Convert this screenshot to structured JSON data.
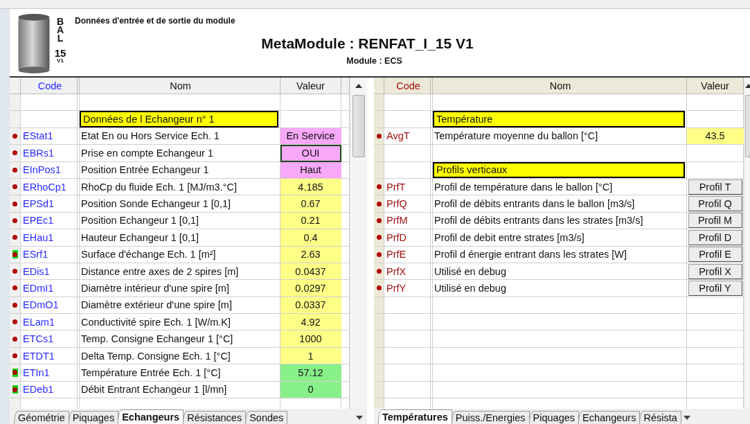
{
  "header": {
    "badge_letters": [
      "B",
      "A",
      "L"
    ],
    "badge_number": "15",
    "badge_version": "V1",
    "caption": "Données d'entrée et de sortie du module",
    "title": "MetaModule : RENFAT_I_15 V1",
    "subtitle": "Module : ECS"
  },
  "grids": [
    {
      "columns": [
        "Code",
        "Nom",
        "Valeur"
      ],
      "rows": [
        {
          "kind": "blank"
        },
        {
          "kind": "section",
          "label": "Données de l Echangeur n° 1"
        },
        {
          "kind": "param",
          "highlighted": false,
          "code": "EStat1",
          "name": "Etat En ou Hors Service Ech. 1",
          "value": "En Service",
          "color": "#f8a8f8",
          "selected": false
        },
        {
          "kind": "param",
          "highlighted": false,
          "code": "EBRs1",
          "name": "Prise en compte Echangeur 1",
          "value": "OUI",
          "color": "#f8a8f8",
          "selected": true
        },
        {
          "kind": "param",
          "highlighted": false,
          "code": "EInPos1",
          "name": "Position Entrée Echangeur 1",
          "value": "Haut",
          "color": "#f8a8f8",
          "selected": false
        },
        {
          "kind": "param",
          "highlighted": false,
          "code": "ERhoCp1",
          "name": "RhoCp du fluide Ech. 1 [MJ/m3.°C]",
          "value": "4.185",
          "color": "#ffff88",
          "selected": false
        },
        {
          "kind": "param",
          "highlighted": false,
          "code": "EPSd1",
          "name": "Position Sonde Echangeur 1 [0,1]",
          "value": "0.67",
          "color": "#ffff88",
          "selected": false
        },
        {
          "kind": "param",
          "highlighted": false,
          "code": "EPEc1",
          "name": "Position Echangeur 1  [0,1]",
          "value": "0.21",
          "color": "#ffff88",
          "selected": false
        },
        {
          "kind": "param",
          "highlighted": false,
          "code": "EHau1",
          "name": "Hauteur Echangeur 1 [0,1]",
          "value": "0.4",
          "color": "#ffff88",
          "selected": false
        },
        {
          "kind": "param",
          "highlighted": true,
          "code": "ESrf1",
          "name": "Surface d'échange Ech. 1 [m²]",
          "value": "2.63",
          "color": "#ffff88",
          "selected": false
        },
        {
          "kind": "param",
          "highlighted": false,
          "code": "EDis1",
          "name": "Distance entre axes de 2 spires [m]",
          "value": "0.0437",
          "color": "#ffff88",
          "selected": false
        },
        {
          "kind": "param",
          "highlighted": false,
          "code": "EDmI1",
          "name": "Diamètre intérieur d'une spire [m]",
          "value": "0.0297",
          "color": "#ffff88",
          "selected": false
        },
        {
          "kind": "param",
          "highlighted": false,
          "code": "EDmO1",
          "name": "Diamètre extérieur d'une spire [m]",
          "value": "0.0337",
          "color": "#ffff88",
          "selected": false
        },
        {
          "kind": "param",
          "highlighted": false,
          "code": "ELam1",
          "name": "Conductivité spire Ech. 1 [W/m.K]",
          "value": "4.92",
          "color": "#ffff88",
          "selected": false
        },
        {
          "kind": "param",
          "highlighted": false,
          "code": "ETCs1",
          "name": "Temp. Consigne Echangeur 1 [°C]",
          "value": "1000",
          "color": "#ffff88",
          "selected": false
        },
        {
          "kind": "param",
          "highlighted": false,
          "code": "ETDT1",
          "name": "Delta Temp. Consigne Ech. 1 [°C]",
          "value": "1",
          "color": "#ffff88",
          "selected": false
        },
        {
          "kind": "param",
          "highlighted": true,
          "code": "ETIn1",
          "name": "Température Entrée Ech. 1 [°C]",
          "value": "57.12",
          "color": "#88f088",
          "selected": false
        },
        {
          "kind": "param",
          "highlighted": true,
          "code": "EDeb1",
          "name": "Débit Entrant Echangeur 1 [l/mn]",
          "value": "0",
          "color": "#88f088",
          "selected": false
        }
      ],
      "tabs": [
        {
          "label": "Géométrie",
          "selected": false
        },
        {
          "label": "Piquages",
          "selected": false
        },
        {
          "label": "Echangeurs",
          "selected": true
        },
        {
          "label": "Résistances",
          "selected": false
        },
        {
          "label": "Sondes",
          "selected": false
        }
      ]
    },
    {
      "columns": [
        "Code",
        "Nom",
        "Valeur"
      ],
      "rows": [
        {
          "kind": "blank"
        },
        {
          "kind": "section",
          "label": "Température"
        },
        {
          "kind": "param",
          "highlighted": false,
          "code": "AvgT",
          "name": "Température moyenne du ballon [°C]",
          "value": "43.5",
          "color": "#ffff88",
          "selected": false
        },
        {
          "kind": "blank"
        },
        {
          "kind": "section",
          "label": "Profils verticaux"
        },
        {
          "kind": "button_param",
          "highlighted": false,
          "code": "PrfT",
          "name": "Profil de température dans le ballon [°C]",
          "value": "Profil T"
        },
        {
          "kind": "button_param",
          "highlighted": false,
          "code": "PrfQ",
          "name": "Profil de débits entrants dans le ballon [m3/s]",
          "value": "Profil Q"
        },
        {
          "kind": "button_param",
          "highlighted": false,
          "code": "PrfM",
          "name": "Profil de débits entrants dans les strates [m3/s]",
          "value": "Profil M"
        },
        {
          "kind": "button_param",
          "highlighted": false,
          "code": "PrfD",
          "name": "Profil de debit entre strates [m3/s]",
          "value": "Profil D"
        },
        {
          "kind": "button_param",
          "highlighted": false,
          "code": "PrfE",
          "name": "Profil d énergie entrant dans les strates [W]",
          "value": "Profil E"
        },
        {
          "kind": "button_param",
          "highlighted": false,
          "code": "PrfX",
          "name": "Utilisé en debug",
          "value": "Profil X"
        },
        {
          "kind": "button_param",
          "highlighted": false,
          "code": "PrfY",
          "name": "Utilisé en debug",
          "value": "Profil Y"
        }
      ],
      "tabs": [
        {
          "label": "Températures",
          "selected": true
        },
        {
          "label": "Puiss./Energies",
          "selected": false
        },
        {
          "label": "Piquages",
          "selected": false
        },
        {
          "label": "Echangeurs",
          "selected": false
        },
        {
          "label": "Résista",
          "selected": false
        }
      ]
    }
  ]
}
